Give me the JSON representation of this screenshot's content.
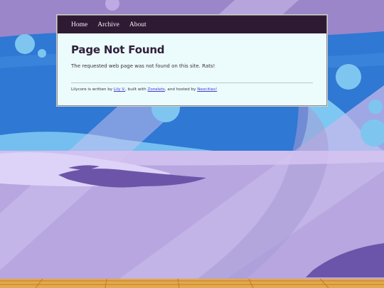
{
  "nav": {
    "items": [
      "Home",
      "Archive",
      "About"
    ]
  },
  "page": {
    "title": "Page Not Found",
    "message": "The requested web page was not found on this site. Rats!"
  },
  "footer": {
    "prefix": "Lilycore is written by ",
    "author_link": "Lily V.",
    "mid1": ", built with ",
    "builder_link": "Zonelets",
    "mid2": ", and hosted by ",
    "host_link": "Neocities!"
  },
  "colors": {
    "sky": "#9a86c9",
    "sea": "#2f78d3",
    "water_light": "#7ec6ef",
    "floor": "#bcaee3",
    "nav_bg": "#2f1a33",
    "card_bg": "#ecfbfb",
    "link": "#3b3bd6"
  }
}
